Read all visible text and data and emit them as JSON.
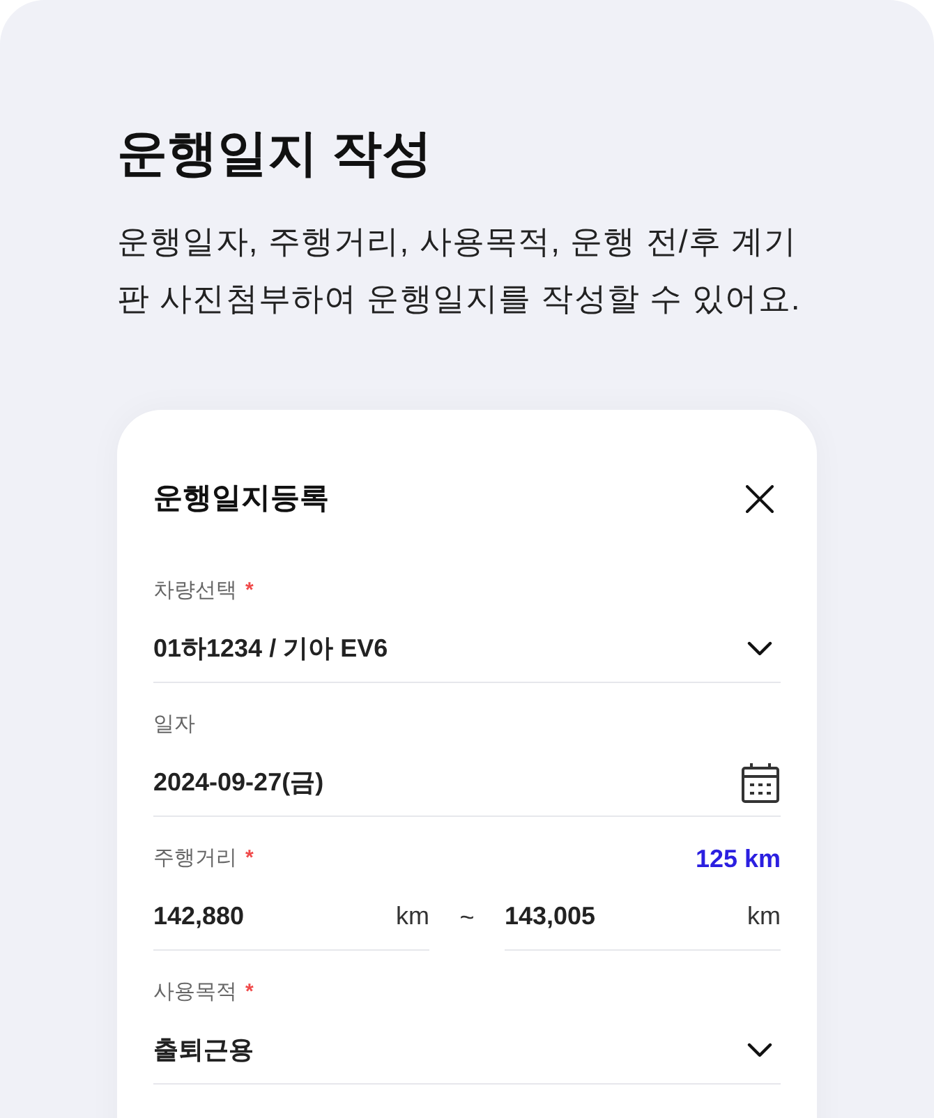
{
  "page": {
    "title": "운행일지 작성",
    "description": "운행일자, 주행거리, 사용목적, 운행 전/후 계기판 사진첨부하여 운행일지를 작성할 수 있어요."
  },
  "dialog": {
    "title": "운행일지등록",
    "fields": [
      {
        "kind": "select",
        "label": "차량선택",
        "required_mark": "*",
        "value": "01하1234 / 기아 EV6"
      },
      {
        "kind": "date",
        "label": "일자",
        "value": "2024-09-27(금)"
      },
      {
        "kind": "range",
        "label": "주행거리",
        "required_mark": "*",
        "total": "125 km",
        "from": {
          "value": "142,880",
          "unit": "km"
        },
        "separator": "~",
        "to": {
          "value": "143,005",
          "unit": "km"
        }
      },
      {
        "kind": "select",
        "label": "사용목적",
        "required_mark": "*",
        "value": "출퇴근용"
      }
    ]
  }
}
